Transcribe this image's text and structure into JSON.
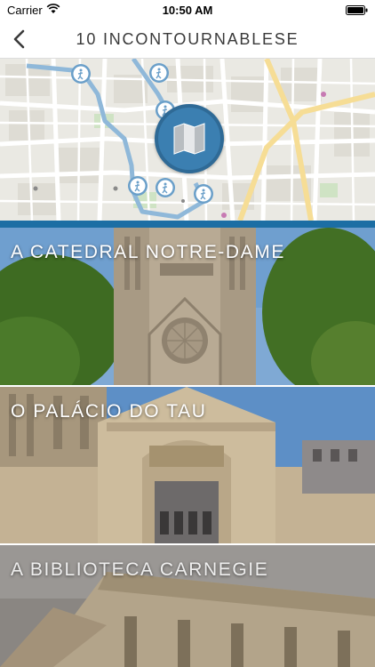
{
  "status_bar": {
    "carrier": "Carrier",
    "time": "10:50 AM"
  },
  "nav": {
    "title": "10 INCONTOURNABLESE",
    "back_icon": "chevron-left-icon"
  },
  "map": {
    "button_icon": "folded-map-icon",
    "accent_color": "#3b7fb1"
  },
  "attractions": [
    {
      "title": "A CATEDRAL NOTRE-DAME"
    },
    {
      "title": "O PALÁCIO DO TAU"
    },
    {
      "title": "A BIBLIOTECA CARNEGIE"
    }
  ],
  "colors": {
    "brand_blue": "#1c6ea4",
    "title_gray": "#3a3a3a"
  }
}
